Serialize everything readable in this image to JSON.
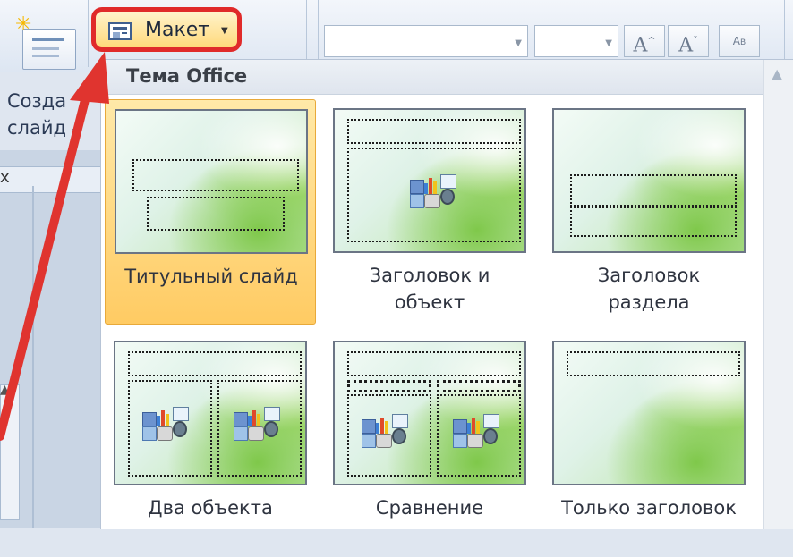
{
  "ribbon": {
    "new_slide_label": "Создать слайд",
    "new_slide_line1": "Созда",
    "new_slide_line2": "слайд",
    "layout_button_label": "Макет"
  },
  "left_panel": {
    "close_label": "x"
  },
  "dropdown": {
    "header": "Тема Office",
    "layouts": [
      {
        "name": "Титульный слайд",
        "selected": true
      },
      {
        "name": "Заголовок и объект",
        "selected": false
      },
      {
        "name": "Заголовок раздела",
        "selected": false
      },
      {
        "name": "Два объекта",
        "selected": false
      },
      {
        "name": "Сравнение",
        "selected": false
      },
      {
        "name": "Только заголовок",
        "selected": false
      }
    ]
  },
  "colors": {
    "highlight_red": "#e02a2a",
    "selected_orange": "#ffcb63",
    "ribbon_bg": "#dde6f2"
  },
  "icons": [
    "new-slide-icon",
    "layout-icon",
    "chevron-down-icon",
    "increase-font-icon",
    "decrease-font-icon",
    "clear-formatting-icon",
    "scroll-up-icon",
    "content-object-icon"
  ]
}
